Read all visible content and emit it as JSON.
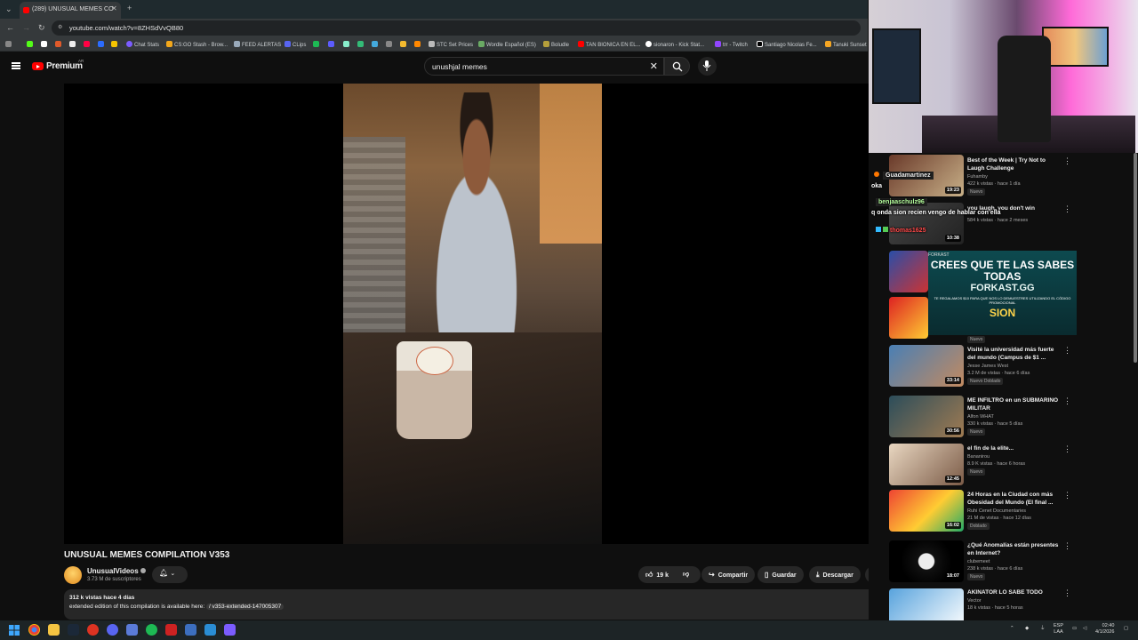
{
  "browser": {
    "tab_title": "(289) UNUSUAL MEMES CO",
    "url": "youtube.com/watch?v=8ZHSdVvQB80",
    "bookmarks": [
      "Chat Stats",
      "CS:GO Stash - Brow...",
      "FEED ALERTAS",
      "CLips",
      "STC Set Prices",
      "Wordle Español (ES)",
      "Boludle",
      "TAN BIONICA EN EL...",
      "sionaron - Kick Stat...",
      "trr - Twitch",
      "Santiago Nicolas Fe...",
      "Tanuki Sunset"
    ]
  },
  "youtube": {
    "brand": "Premium",
    "region": "AR",
    "search_query": "unushjal memes",
    "video_title": "UNUSUAL MEMES COMPILATION V353",
    "channel_name": "UnusualVideos",
    "subscribers": "3.73 M de suscriptores",
    "likes": "19 k",
    "share_label": "Compartir",
    "save_label": "Guardar",
    "download_label": "Descargar",
    "views_date": "312 k vistas  hace 4 días",
    "description": "extended edition of this compilation is available here:",
    "description_link": "/ v353-extended-147005307"
  },
  "chat_overlay": [
    {
      "user": "Guadamartinez",
      "message": "oka",
      "color": "#d7b7ff"
    },
    {
      "user": "benjaaschulz96",
      "message": "q onda sion recien vengo de hablar con ella",
      "color": "#b6ff9e"
    },
    {
      "user": "thomas1625",
      "message": "",
      "color": "#ff4a4a"
    }
  ],
  "ad": {
    "label": "FORKAST",
    "line1": "CREES QUE TE LAS SABES TODAS",
    "line2": "FORKAST.GG",
    "line3": "TE REGALAMOS $10 PARA QUE NOS LO DEMUESTRES UTILIZANDO EL CÓDIGO PROMOCIONAL",
    "code": "SION"
  },
  "recommendations": [
    {
      "title": "Best of the Week | Try Not to Laugh Challenge",
      "channel": "Fuhamby",
      "meta": "422 k vistas · hace 1 día",
      "badge": "Nuevo",
      "duration": "19:23"
    },
    {
      "title": "you laugh, you don't win",
      "channel": "",
      "meta": "584 k vistas · hace 2 meses",
      "badge": "",
      "duration": "10:38"
    },
    {
      "title": "Visité la universidad más fuerte del mundo (Campus de $1 ...",
      "channel": "Jesse James West",
      "meta": "3.2 M de vistas · hace 6 días",
      "badge": "Nuevo  Doblado",
      "duration": "33:14"
    },
    {
      "title": "ME INFILTRO en un SUBMARINO MILITAR",
      "channel": "Alfon WHAT",
      "meta": "330 k vistas · hace 5 días",
      "badge": "Nuevo",
      "duration": "30:56"
    },
    {
      "title": "el fin de la elite...",
      "channel": "Bananirou",
      "meta": "8.9 K vistas · hace 6 horas",
      "badge": "Nuevo",
      "duration": "12:45"
    },
    {
      "title": "24 Horas en la Ciudad con más Obesidad del Mundo (El final ...",
      "channel": "Ruhi Cenet Documentaries",
      "meta": "21 M de vistas · hace 12 días",
      "badge": "Doblado",
      "duration": "16:02"
    },
    {
      "title": "¿Qué Anomalías están presentes en Internet?",
      "channel": "clubemeet",
      "meta": "238 k vistas · hace 6 días",
      "badge": "Nuevo",
      "duration": "18:07"
    },
    {
      "title": "AKINATOR LO SABE TODO",
      "channel": "Vector",
      "meta": "18 k vistas · hace 5 horas",
      "badge": "",
      "duration": ""
    }
  ],
  "taskbar": {
    "lang": "ESP",
    "lang2": "LAA",
    "time": "02:40",
    "date": "4/1/2026"
  }
}
